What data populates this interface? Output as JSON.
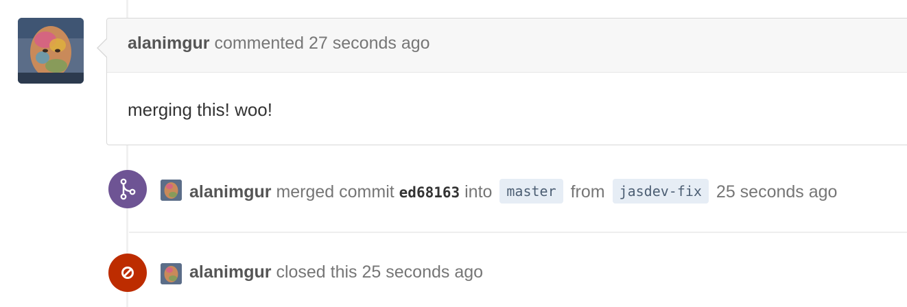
{
  "comment": {
    "author": "alanimgur",
    "action": "commented",
    "time": "27 seconds ago",
    "body": "merging this! woo!"
  },
  "merge_event": {
    "author": "alanimgur",
    "action": "merged commit",
    "commit": "ed68163",
    "into_word": "into",
    "base_branch": "master",
    "from_word": "from",
    "head_branch": "jasdev-fix",
    "time": "25 seconds ago",
    "icon": "git-merge-icon",
    "color": "#6e5494"
  },
  "close_event": {
    "author": "alanimgur",
    "action": "closed this",
    "time": "25 seconds ago",
    "icon": "circle-slash-icon",
    "color": "#bd2c00"
  }
}
